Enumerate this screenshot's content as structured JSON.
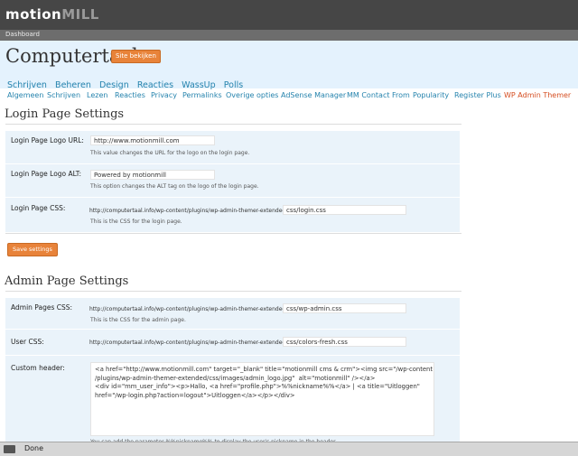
{
  "brand": {
    "part1": "motion",
    "part2": "MILL"
  },
  "dashboard_label": "Dashboard",
  "site_title": "Computertaal",
  "view_site_label": "Site bekijken",
  "main_nav": [
    "Schrijven",
    "Beheren",
    "Design",
    "Reacties",
    "WassUp",
    "Polls"
  ],
  "sub_nav": [
    "Algemeen",
    "Schrijven",
    "Lezen",
    "Reacties",
    "Privacy",
    "Permalinks",
    "Overige opties",
    "AdSense Manager",
    "MM Contact From",
    "Popularity",
    "Register Plus",
    "WP Admin Themer"
  ],
  "login": {
    "heading": "Login Page Settings",
    "logo_url_label": "Login Page Logo URL:",
    "logo_url_value": "http://www.motionmill.com",
    "logo_url_desc": "This value changes the URL for the logo on the login page.",
    "logo_alt_label": "Login Page Logo ALT:",
    "logo_alt_value": "Powered by motionmill",
    "logo_alt_desc": "This option changes the ALT tag on the logo of the login page.",
    "css_label": "Login Page CSS:",
    "css_prefix": "http://computertaal.info/wp-content/plugins/wp-admin-themer-extended/",
    "css_value": "css/login.css",
    "css_desc": "This is the CSS for the login page.",
    "save_label": "Save settings"
  },
  "admin": {
    "heading": "Admin Page Settings",
    "pages_css_label": "Admin Pages CSS:",
    "pages_css_prefix": "http://computertaal.info/wp-content/plugins/wp-admin-themer-extended/",
    "pages_css_value": "css/wp-admin.css",
    "pages_css_desc": "This is the CSS for the admin page.",
    "user_css_label": "User CSS:",
    "user_css_prefix": "http://computertaal.info/wp-content/plugins/wp-admin-themer-extended/",
    "user_css_value": "css/colors-fresh.css",
    "custom_header_label": "Custom header:",
    "custom_header_value": "<a href=\"http://www.motionmill.com\" target=\"_blank\" title=\"motionmill cms & crm\"><img src=\"/wp-content\n/plugins/wp-admin-themer-extended/css/images/admin_logo.jpg\"  alt=\"motionmill\" /></a>\n<div id=\"mm_user_info\"><p>Hallo, <a href=\"profile.php\">%%nickname%%</a> | <a title=\"Uitloggen\"\nhref=\"/wp-login.php?action=logout\">Uitloggen</a></p></div>",
    "custom_header_desc": "You can add the parameter %%nickname%% to display the user's nickname in the header."
  },
  "status_text": "Done"
}
